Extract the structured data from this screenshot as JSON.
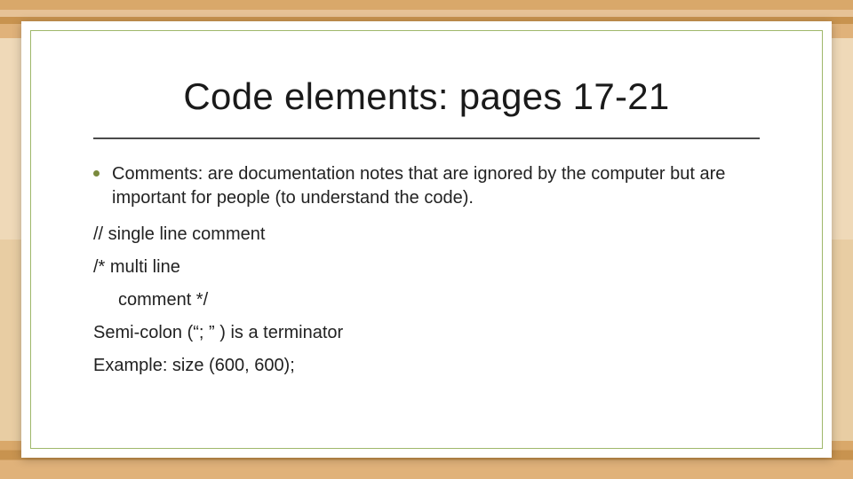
{
  "slide": {
    "title": "Code elements: pages 17-21",
    "bullet1": "Comments: are documentation notes that are ignored by the computer but are important for people (to understand the code).",
    "line_single": "// single line comment",
    "line_multi1": "/*  multi line",
    "line_multi2": "comment */",
    "line_semi": "Semi-colon (“; ” ) is a terminator",
    "line_example": "Example: size (600, 600);"
  }
}
